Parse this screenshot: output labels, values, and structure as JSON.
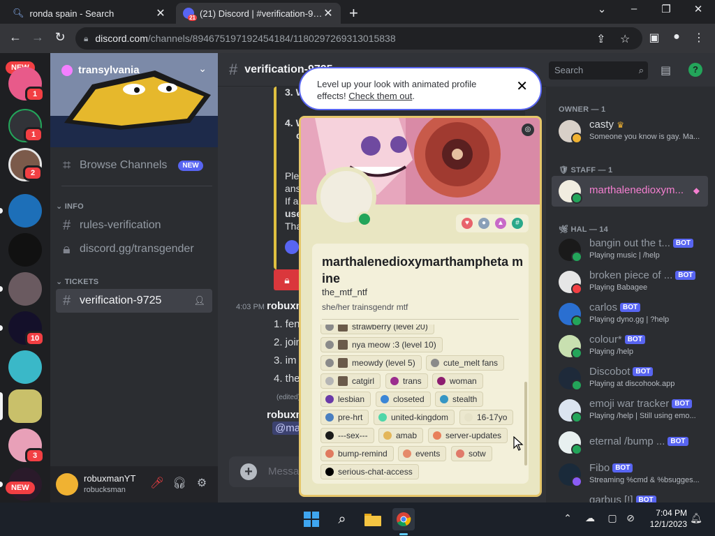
{
  "browser": {
    "tabs": [
      {
        "title": "ronda spain - Search",
        "active": false
      },
      {
        "title": "(21) Discord | #verification-9725",
        "active": true,
        "badge": "21"
      }
    ],
    "url_host": "discord.com",
    "url_path": "/channels/894675197192454184/1180297269313015838"
  },
  "server": {
    "name": "transylvania",
    "channels": [
      {
        "name": "Browse Channels",
        "badge": "NEW"
      }
    ],
    "categories": [
      {
        "name": "INFO",
        "channels": [
          "rules-verification",
          "discord.gg/transgender"
        ]
      },
      {
        "name": "TICKETS",
        "channels": [
          "verification-9725"
        ]
      }
    ]
  },
  "guild_badges": {
    "new_top": "NEW",
    "g1": "1",
    "g2": "1",
    "g3": "2",
    "g4": "10",
    "g5": "3",
    "new_bottom": "NEW"
  },
  "user_panel": {
    "name": "robuxmanYT",
    "sub": "robucksman"
  },
  "chat": {
    "channel": "verification-9725",
    "embed_lines": {
      "l3": "3. W",
      "l4a": "4. W",
      "l4b": "c",
      "ple": "Ple",
      "ans": "ans",
      "ifa": "If a",
      "use": "use",
      "tha": "Tha"
    },
    "message": {
      "time": "4:03 PM",
      "author": "robuxm",
      "lines": [
        "1. fen",
        "2. join",
        "3. im",
        "4. the"
      ],
      "edited": "(edited)"
    },
    "message2_author": "robuxm",
    "mention": "@ma",
    "composer_placeholder": "Messa"
  },
  "notification": {
    "text": "Level up your look with animated profile effects! ",
    "link": "Check them out",
    "period": "."
  },
  "profile": {
    "display_name": "marthalenedioxymarthampheta mine",
    "username": "the_mtf_ntf",
    "pronouns": "she/her trainsgendr mtf",
    "roles": [
      {
        "name": "strawberry (level 20)",
        "thumb": true,
        "color": "#8a8a8a"
      },
      {
        "name": "nya meow :3 (level 10)",
        "thumb": true,
        "color": "#8a8a8a"
      },
      {
        "name": "meowdy (level 5)",
        "thumb": true,
        "color": "#8a8a8a"
      },
      {
        "name": "cute_melt fans",
        "thumb": false,
        "color": "#8a8a8a"
      },
      {
        "name": "catgirl",
        "thumb": true,
        "color": "#b5b5b5"
      },
      {
        "name": "trans",
        "thumb": false,
        "color": "#9b2d8e"
      },
      {
        "name": "woman",
        "thumb": false,
        "color": "#8c1d6f"
      },
      {
        "name": "lesbian",
        "thumb": false,
        "color": "#6a3aa8"
      },
      {
        "name": "closeted",
        "thumb": false,
        "color": "#3b86d6"
      },
      {
        "name": "stealth",
        "thumb": false,
        "color": "#3596c4"
      },
      {
        "name": "pre-hrt",
        "thumb": false,
        "color": "#4a7fc0"
      },
      {
        "name": "united-kingdom",
        "thumb": false,
        "color": "#4ed6a8"
      },
      {
        "name": "16-17yo",
        "thumb": false,
        "color": "#e6e2c8"
      },
      {
        "name": "---sex---",
        "thumb": false,
        "color": "#1a1a1a"
      },
      {
        "name": "amab",
        "thumb": false,
        "color": "#e3b65a"
      },
      {
        "name": "server-updates",
        "thumb": false,
        "color": "#e87f5a"
      },
      {
        "name": "bump-remind",
        "thumb": false,
        "color": "#e07a5f"
      },
      {
        "name": "events",
        "thumb": false,
        "color": "#e58a6a"
      },
      {
        "name": "sotw",
        "thumb": false,
        "color": "#e07a6a"
      },
      {
        "name": "serious-chat-access",
        "thumb": false,
        "color": "#000000"
      }
    ]
  },
  "members": {
    "search_placeholder": "Search",
    "groups": [
      {
        "role": "OWNER — 1",
        "members": [
          {
            "name": "casty",
            "crown": true,
            "activity": "Someone you know is gay. Ma...",
            "color": "#949ba4"
          }
        ]
      },
      {
        "role": "STAFF — 1",
        "members": [
          {
            "name": "marthalenedioxym...",
            "activity": "",
            "color": "#f47fd0"
          }
        ]
      },
      {
        "role": "HAL — 14",
        "members": [
          {
            "name": "bangin out the t...",
            "bot": "BOT",
            "activity": "Playing music | /help"
          },
          {
            "name": "broken piece of ...",
            "bot": "BOT",
            "activity": "Playing Babagee"
          },
          {
            "name": "carlos",
            "bot": "BOT",
            "activity": "Playing dyno.gg | ?help"
          },
          {
            "name": "colour*",
            "bot": "BOT",
            "activity": "Playing /help"
          },
          {
            "name": "Discobot",
            "bot": "BOT",
            "activity": "Playing at discohook.app"
          },
          {
            "name": "emoji war tracker",
            "bot": "BOT",
            "activity": "Playing /help | Still using emo..."
          },
          {
            "name": "eternal /bump ...",
            "bot": "BOT",
            "activity": ""
          },
          {
            "name": "Fibo",
            "bot": "BOT",
            "activity": "Streaming %cmd & %bsugges..."
          },
          {
            "name": "garbus [!]",
            "bot": "BOT",
            "activity": ""
          }
        ]
      }
    ]
  },
  "taskbar": {
    "time": "7:04 PM",
    "date": "12/1/2023"
  },
  "colors": {
    "discord_bg": "#313338",
    "sidebar_bg": "#2b2d31",
    "blurple": "#5865f2",
    "online": "#23a55a",
    "danger": "#f23f43"
  }
}
